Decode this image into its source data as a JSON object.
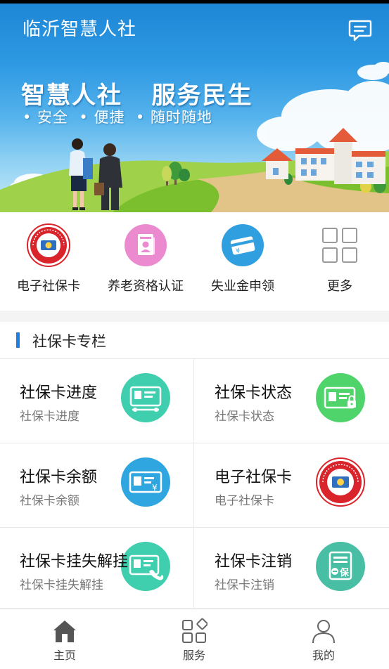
{
  "app": {
    "title": "临沂智慧人社"
  },
  "header": {
    "message_icon": "message-icon"
  },
  "banner": {
    "slogan_main": "智慧人社   服务民生",
    "slogan_sub": "• 安全  • 便捷  • 随时随地"
  },
  "quick_services": [
    {
      "label": "电子社保卡",
      "icon": "social-security-card-icon"
    },
    {
      "label": "养老资格认证",
      "icon": "pension-certificate-icon"
    },
    {
      "label": "失业金申领",
      "icon": "unemployment-card-icon"
    },
    {
      "label": "更多",
      "icon": "more-grid-icon"
    }
  ],
  "section": {
    "title": "社保卡专栏"
  },
  "card_services": [
    {
      "title": "社保卡进度",
      "subtitle": "社保卡进度",
      "icon": "card-progress-icon",
      "color": "#3fcfae"
    },
    {
      "title": "社保卡状态",
      "subtitle": "社保卡状态",
      "icon": "card-status-icon",
      "color": "#4fd46b"
    },
    {
      "title": "社保卡余额",
      "subtitle": "社保卡余额",
      "icon": "card-balance-icon",
      "color": "#2fa6e0"
    },
    {
      "title": "电子社保卡",
      "subtitle": "电子社保卡",
      "icon": "social-security-card-icon",
      "color": "#d9242b"
    },
    {
      "title": "社保卡挂失解挂",
      "subtitle": "社保卡挂失解挂",
      "icon": "card-loss-phone-icon",
      "color": "#3fcfae"
    },
    {
      "title": "社保卡注销",
      "subtitle": "社保卡注销",
      "icon": "card-cancel-icon",
      "color": "#48bfa5"
    }
  ],
  "tabbar": [
    {
      "label": "主页",
      "icon": "home-icon",
      "active": true
    },
    {
      "label": "服务",
      "icon": "services-grid-icon",
      "active": false
    },
    {
      "label": "我的",
      "icon": "profile-icon",
      "active": false
    }
  ],
  "colors": {
    "accent": "#1f7fe0",
    "banner_blue": "#1d86d6",
    "active_tab": "#555555"
  }
}
